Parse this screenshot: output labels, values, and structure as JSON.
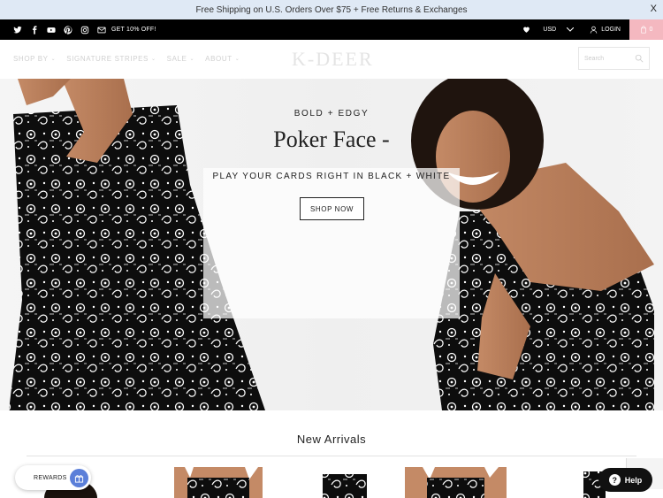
{
  "announcement": {
    "text": "Free Shipping on U.S. Orders Over $75 + Free Returns & Exchanges",
    "close": "X"
  },
  "topbar": {
    "social_icons": [
      "twitter-icon",
      "facebook-icon",
      "youtube-icon",
      "pinterest-icon",
      "instagram-icon",
      "mail-icon"
    ],
    "promo": "GET 10% OFF!",
    "currency": "USD",
    "login": "LOGIN",
    "cart_count": "0"
  },
  "nav": {
    "items": [
      {
        "label": "SHOP BY"
      },
      {
        "label": "SIGNATURE STRIPES"
      },
      {
        "label": "SALE"
      },
      {
        "label": "ABOUT"
      }
    ],
    "logo": "K-DEER",
    "search_placeholder": "Search"
  },
  "hero": {
    "kicker": "BOLD + EDGY",
    "headline": "Poker Face -",
    "sub": "PLAY YOUR CARDS RIGHT IN BLACK + WHITE",
    "cta": "SHOP NOW"
  },
  "section": {
    "title": "New Arrivals"
  },
  "widgets": {
    "rewards": "REWARDS",
    "help": "Help"
  },
  "colors": {
    "announcement_bg": "#dfe9f5",
    "topbar_bg": "#000000",
    "cart_bg": "#f4b8c0",
    "rewards_accent": "#5b7fd9"
  }
}
